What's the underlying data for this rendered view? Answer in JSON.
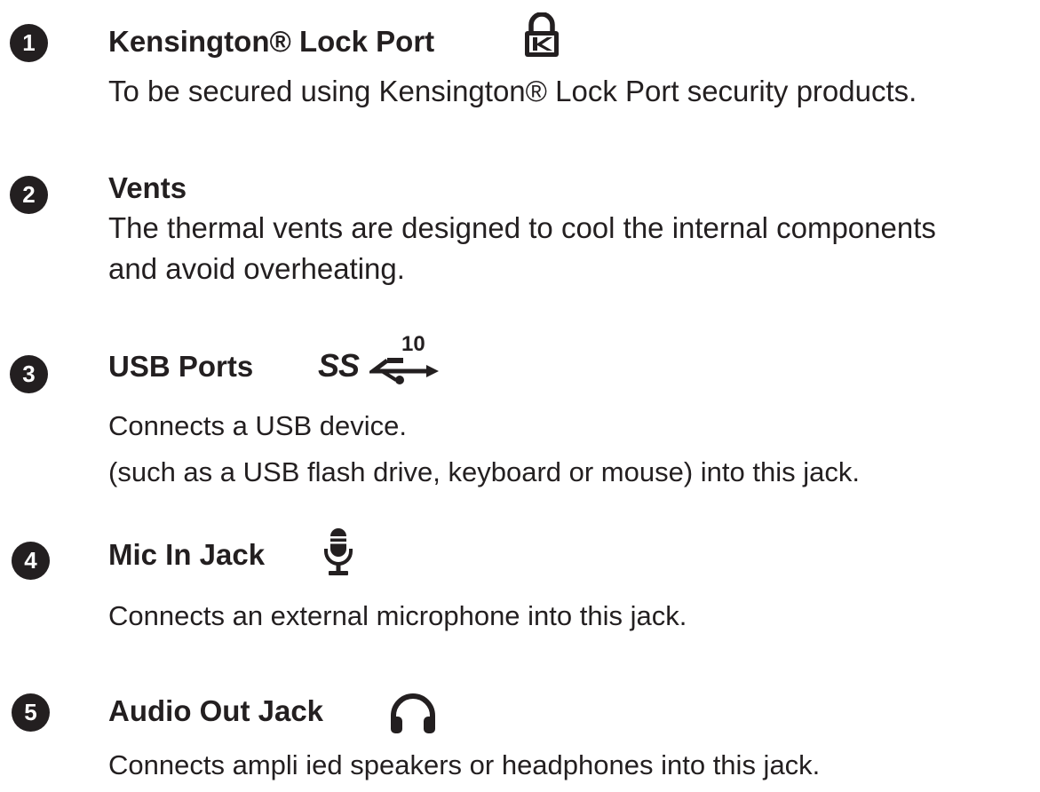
{
  "items": [
    {
      "number": "1",
      "title": "Kensington® Lock Port",
      "icon": "kensington-lock-icon",
      "lines": [
        "To be secured using Kensington® Lock Port security products."
      ]
    },
    {
      "number": "2",
      "title": "Vents",
      "lines": [
        "The thermal vents are designed to cool the internal components",
        "and avoid overheating."
      ]
    },
    {
      "number": "3",
      "title": "USB Ports",
      "icon": "usb-superspeed-10-icon",
      "icon_text": "SS",
      "icon_number": "10",
      "lines": [
        "Connects a USB device.",
        "(such as a USB flash drive, keyboard or mouse) into this jack."
      ]
    },
    {
      "number": "4",
      "title": "Mic In Jack",
      "icon": "microphone-icon",
      "lines": [
        "Connects an external microphone into this jack."
      ]
    },
    {
      "number": "5",
      "title": "Audio Out Jack",
      "icon": "headphones-icon",
      "lines": [
        "Connects ampli ied speakers or headphones into this jack."
      ]
    }
  ]
}
